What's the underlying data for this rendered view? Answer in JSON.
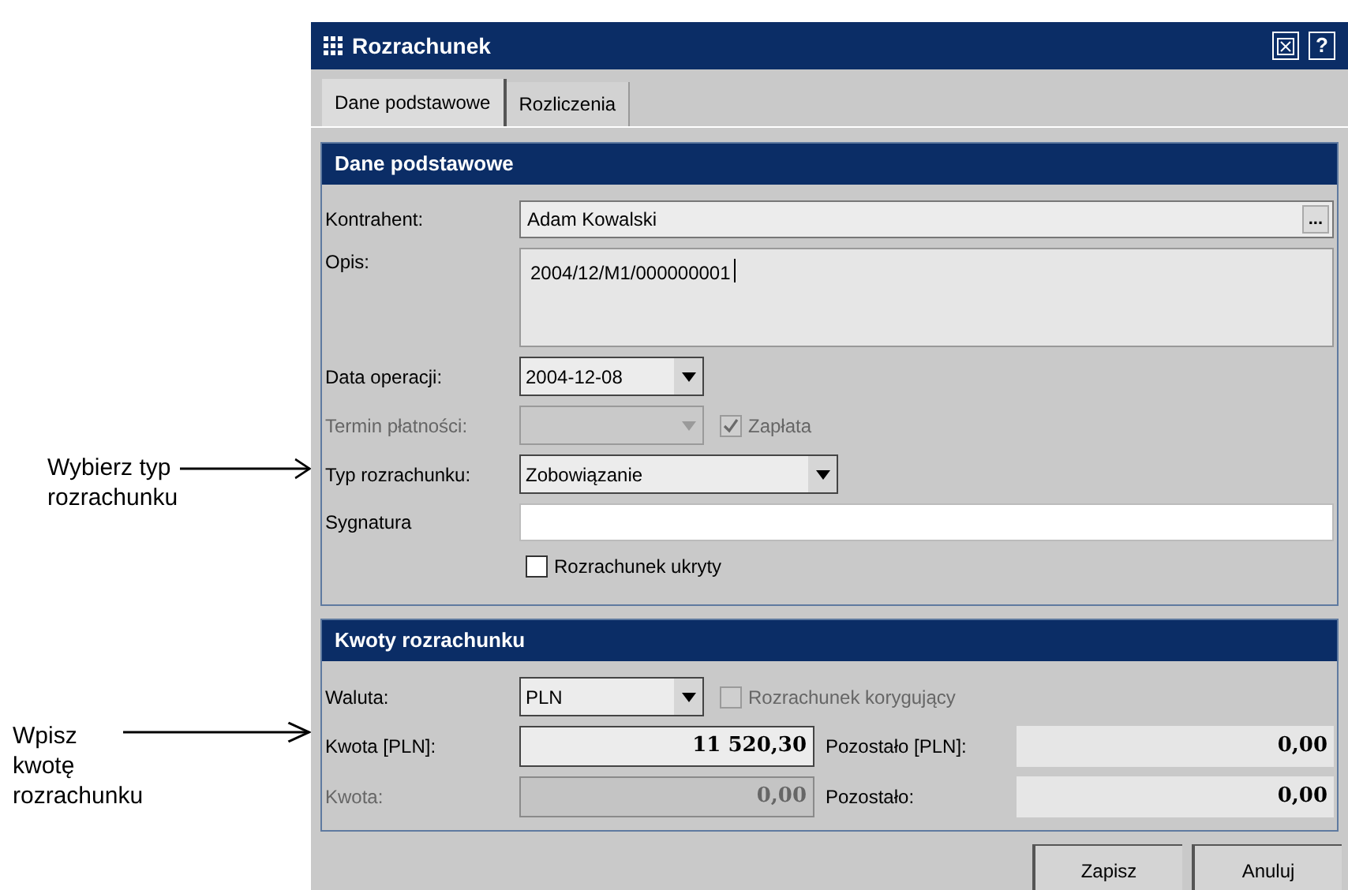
{
  "annotations": [
    {
      "text": "Wybierz typ\nrozrachunku",
      "kind": "type"
    },
    {
      "text": "Wpisz\nkwotę\nrozrachunku",
      "kind": "amount"
    }
  ],
  "window": {
    "title": "Rozrachunek",
    "help_button": "?"
  },
  "tabs": [
    {
      "label": "Dane podstawowe",
      "selected": true
    },
    {
      "label": "Rozliczenia",
      "selected": false
    }
  ],
  "sections": [
    {
      "title": "Dane podstawowe",
      "rows": [
        {
          "kind": "lookup",
          "label": "Kontrahent:",
          "value": "Adam Kowalski",
          "button": "..."
        },
        {
          "kind": "memo",
          "label": "Opis:",
          "value": "2004/12/M1/000000001",
          "focused": true
        },
        {
          "kind": "dropdown",
          "label": "Data operacji:",
          "value": "2004-12-08",
          "disabled": false
        },
        {
          "kind": "dropdown",
          "label": "Termin płatności:",
          "disabled": true,
          "check": {
            "label": "Zapłata",
            "checked": true,
            "disabled": true
          }
        },
        {
          "kind": "dropdown",
          "label": "Typ rozrachunku:",
          "value": "Zobowiązanie",
          "disabled": false,
          "wide": true
        },
        {
          "kind": "text",
          "label": "Sygnatura"
        },
        {
          "kind": "checkbox",
          "label": "Rozrachunek ukryty",
          "checked": false
        }
      ]
    },
    {
      "title": "Kwoty rozrachunku",
      "rows": [
        {
          "kind": "dropdown",
          "label": "Waluta:",
          "value": "PLN",
          "disabled": false,
          "check": {
            "label": "Rozrachunek korygujący",
            "checked": false,
            "disabled": true
          }
        },
        {
          "kind": "amount",
          "label": "Kwota [PLN]:",
          "value": "11 520,30",
          "disabled": false,
          "right_label": "Pozostało [PLN]:",
          "right_value": "0,00"
        },
        {
          "kind": "amount",
          "label": "Kwota:",
          "value": "0,00",
          "disabled": true,
          "right_label": "Pozostało:",
          "right_value": "0,00"
        }
      ]
    }
  ],
  "buttons": [
    "Zapisz",
    "Anuluj"
  ]
}
